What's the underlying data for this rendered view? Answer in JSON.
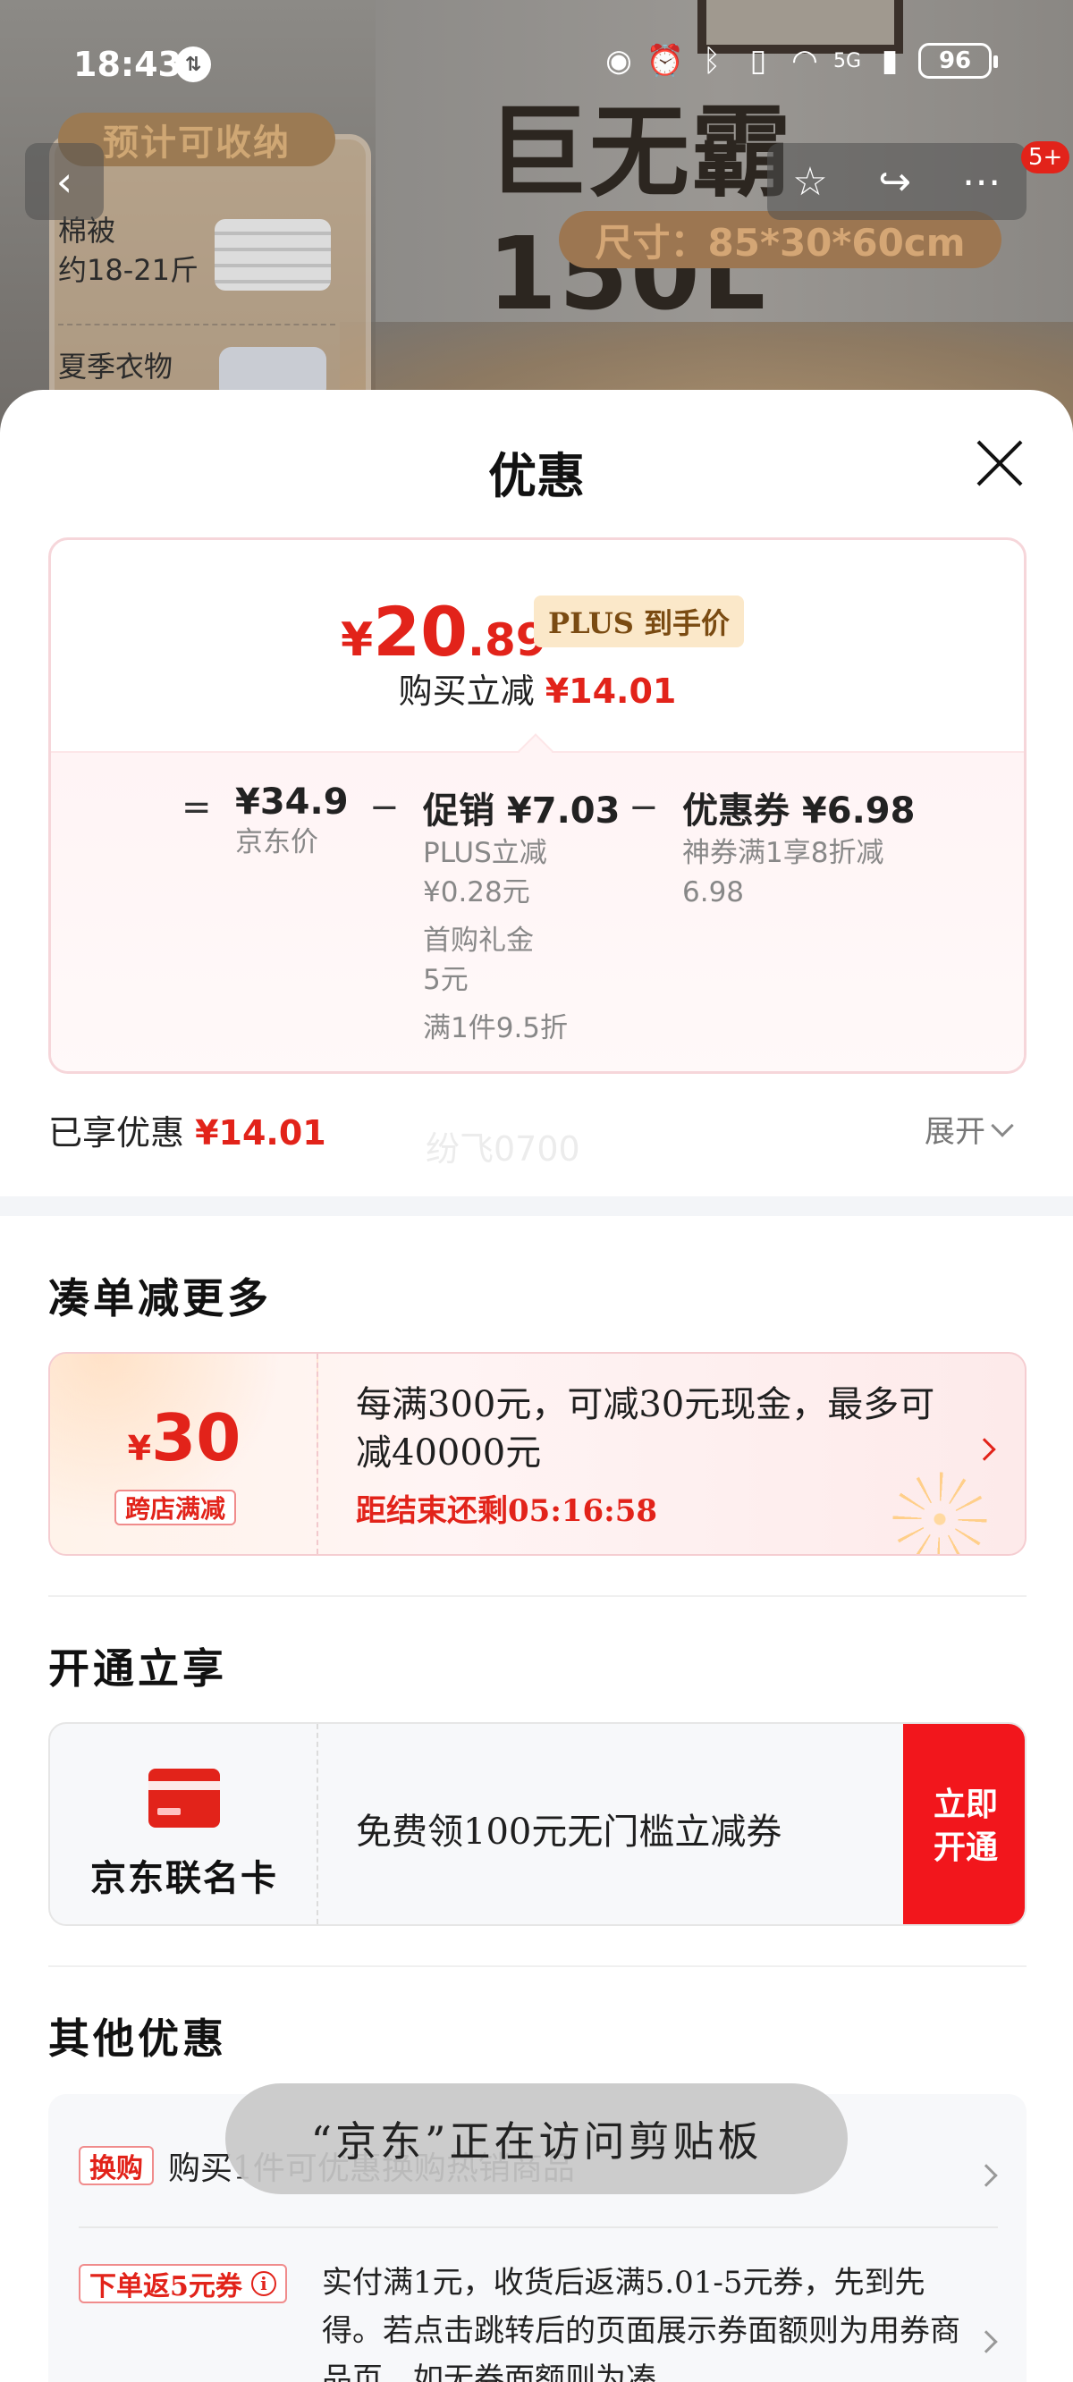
{
  "status_bar": {
    "time": "18:43",
    "battery": "96",
    "network": "5G",
    "icons": [
      "eye-icon",
      "alarm-icon",
      "bluetooth-icon",
      "vibrate-icon",
      "wifi-icon",
      "signal-icon",
      "battery-icon"
    ]
  },
  "product_bg": {
    "headline": "巨无霸150L",
    "capacity_pill": "预计可收纳",
    "size_pill": "尺寸：85*30*60cm",
    "item1_name": "棉被",
    "item1_amount": "约18-21斤",
    "item2_name": "夏季衣物"
  },
  "nav": {
    "cart_badge": "5+",
    "icons": [
      "back-icon",
      "star-icon",
      "share-icon",
      "more-icon"
    ]
  },
  "sheet": {
    "title": "优惠",
    "price": {
      "currency": "¥",
      "integer": "20",
      "decimal": ".89",
      "plus_label": "PLUS 到手价",
      "reduce_label": "购买立减",
      "reduce_amount": "¥14.01"
    },
    "breakdown": {
      "eq": "=",
      "jd_price": "¥34.9",
      "jd_price_label": "京东价",
      "minus1": "−",
      "promo_head": "促销 ¥7.03",
      "promo_item1_line1": "PLUS立减",
      "promo_item1_line2": "¥0.28元",
      "promo_item2_line1": "首购礼金",
      "promo_item2_line2": "5元",
      "promo_item3": "满1件9.5折",
      "minus2": "−",
      "coupon_head": "优惠券 ¥6.98",
      "coupon_line1": "神券满1享8折减",
      "coupon_line2": "6.98"
    },
    "enjoyed_label": "已享优惠",
    "enjoyed_amount": "¥14.01",
    "expand_label": "展开",
    "watermark": "纷飞0700"
  },
  "section_more": {
    "title": "凑单减更多",
    "promo": {
      "currency": "¥",
      "amount": "30",
      "tag": "跨店满减",
      "text": "每满300元，可减30元现金，最多可减40000元",
      "countdown_label": "距结束还剩",
      "countdown": "05:16:58"
    }
  },
  "section_open": {
    "title": "开通立享",
    "card_name": "京东联名卡",
    "offer_text": "免费领100元无门槛立减券",
    "button": "立即开通"
  },
  "section_other": {
    "title": "其他优惠",
    "row1_tag": "换购",
    "row1_text": "购买1件可优惠换购热销商品",
    "row2_tag": "下单返5元券",
    "row2_text": "实付满1元，收货后返满5.01-5元券，先到先得。若点击跳转后的页面展示券面额则为用券商品页，如无券面额则为凑"
  },
  "toast": "“京东”正在访问剪贴板",
  "colors": {
    "accent_red": "#e2231a",
    "plus_tag_bg": "#fbe8c9",
    "plus_tag_text": "#7a4b12"
  }
}
